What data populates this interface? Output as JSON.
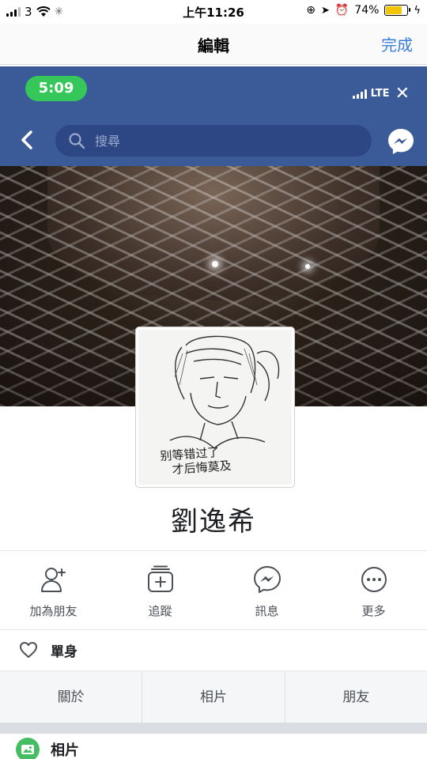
{
  "ios_status": {
    "carrier": "3",
    "time": "上午11:26",
    "battery_percent": "74%",
    "battery_level": 0.74
  },
  "editor": {
    "title": "編輯",
    "done_label": "完成"
  },
  "fb_status": {
    "time": "5:09",
    "network": "LTE"
  },
  "fb_nav": {
    "search_placeholder": "搜尋"
  },
  "profile": {
    "name": "劉逸希",
    "picture_caption_line1": "别等错过了",
    "picture_caption_line2": "才后悔莫及"
  },
  "actions": [
    {
      "label": "加為朋友",
      "icon": "add-friend-icon"
    },
    {
      "label": "追蹤",
      "icon": "follow-icon"
    },
    {
      "label": "訊息",
      "icon": "messenger-icon"
    },
    {
      "label": "更多",
      "icon": "more-icon"
    }
  ],
  "relationship": {
    "label": "單身",
    "icon": "heart-icon"
  },
  "tabs": [
    "關於",
    "相片",
    "朋友"
  ],
  "section": {
    "title": "相片",
    "icon": "photo-icon"
  },
  "colors": {
    "facebook_blue": "#3b5a98",
    "ios_link_blue": "#3d7ddc",
    "time_pill_green": "#35c759",
    "photo_icon_green": "#45bd62"
  }
}
